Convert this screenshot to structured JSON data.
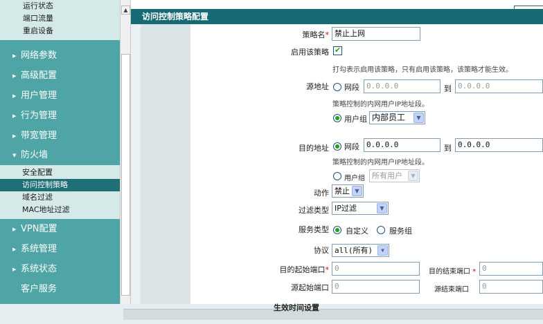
{
  "sidebar": {
    "top_items": [
      "运行状态",
      "端口流量",
      "重启设备"
    ],
    "sections": [
      {
        "label": "网络参数",
        "open": false
      },
      {
        "label": "高级配置",
        "open": false
      },
      {
        "label": "用户管理",
        "open": false
      },
      {
        "label": "行为管理",
        "open": false
      },
      {
        "label": "带宽管理",
        "open": false
      },
      {
        "label": "防火墙",
        "open": true
      }
    ],
    "firewall_items": [
      "安全配置",
      "访问控制策略",
      "域名过滤",
      "MAC地址过滤"
    ],
    "active_item": "访问控制策略",
    "sections_after": [
      {
        "label": "VPN配置"
      },
      {
        "label": "系统管理"
      },
      {
        "label": "系统状态"
      },
      {
        "label": "客户服务"
      }
    ],
    "collapsed_arrow": "▶",
    "open_arrow": "▼"
  },
  "page": {
    "title": "访问控制策略配置"
  },
  "form": {
    "policy_name_label": "策略名",
    "required_mark": "*",
    "policy_name_value": "禁止上网",
    "enable_label": "启用该策略",
    "enable_checked": true,
    "enable_note": "打勾表示启用该策略，只有启用该策略，该策略才能生效。",
    "src_label": "源地址",
    "src_segment_label": "网段",
    "src_start_ip": "0.0.0.0",
    "to_label": "到",
    "src_end_ip": "0.0.0.0",
    "src_note": "策略控制的内网用户IP地址段。",
    "src_group_label": "用户组",
    "src_group_value": "内部员工",
    "src_mode": "group",
    "dst_label": "目的地址",
    "dst_segment_label": "网段",
    "dst_start_ip": "0.0.0.0",
    "dst_end_ip": "0.0.0.0",
    "dst_note": "策略控制的内网用户IP地址段。",
    "dst_group_label": "用户组",
    "dst_group_value": "所有用户",
    "dst_mode": "segment",
    "action_label": "动作",
    "action_value": "禁止",
    "filter_type_label": "过滤类型",
    "filter_type_value": "IP过滤",
    "service_type_label": "服务类型",
    "service_custom_label": "自定义",
    "service_group_label": "服务组",
    "service_mode": "custom",
    "protocol_label": "协议",
    "protocol_value": "all(所有)",
    "dst_start_port_label": "目的起始端口",
    "dst_start_port_value": "0",
    "dst_end_port_label": "目的结束端口",
    "dst_end_port_value": "0",
    "src_start_port_label": "源起始端口",
    "src_start_port_value": "0",
    "src_end_port_label": "源结束端口",
    "src_end_port_value": "0",
    "time_section_title": "生效时间设置"
  },
  "colors": {
    "sidebar_bg": "#4fa5a5",
    "sidebar_sub_bg": "#d5e9e9",
    "active_item_bg": "#1f6f77",
    "header_bg": "#166a75",
    "required": "#e00000",
    "radio_dot": "#21a121"
  },
  "icons": {
    "scroll_up": "chevron-up-icon",
    "dropdown": "chevron-down-icon",
    "checkbox": "checkmark-icon"
  }
}
